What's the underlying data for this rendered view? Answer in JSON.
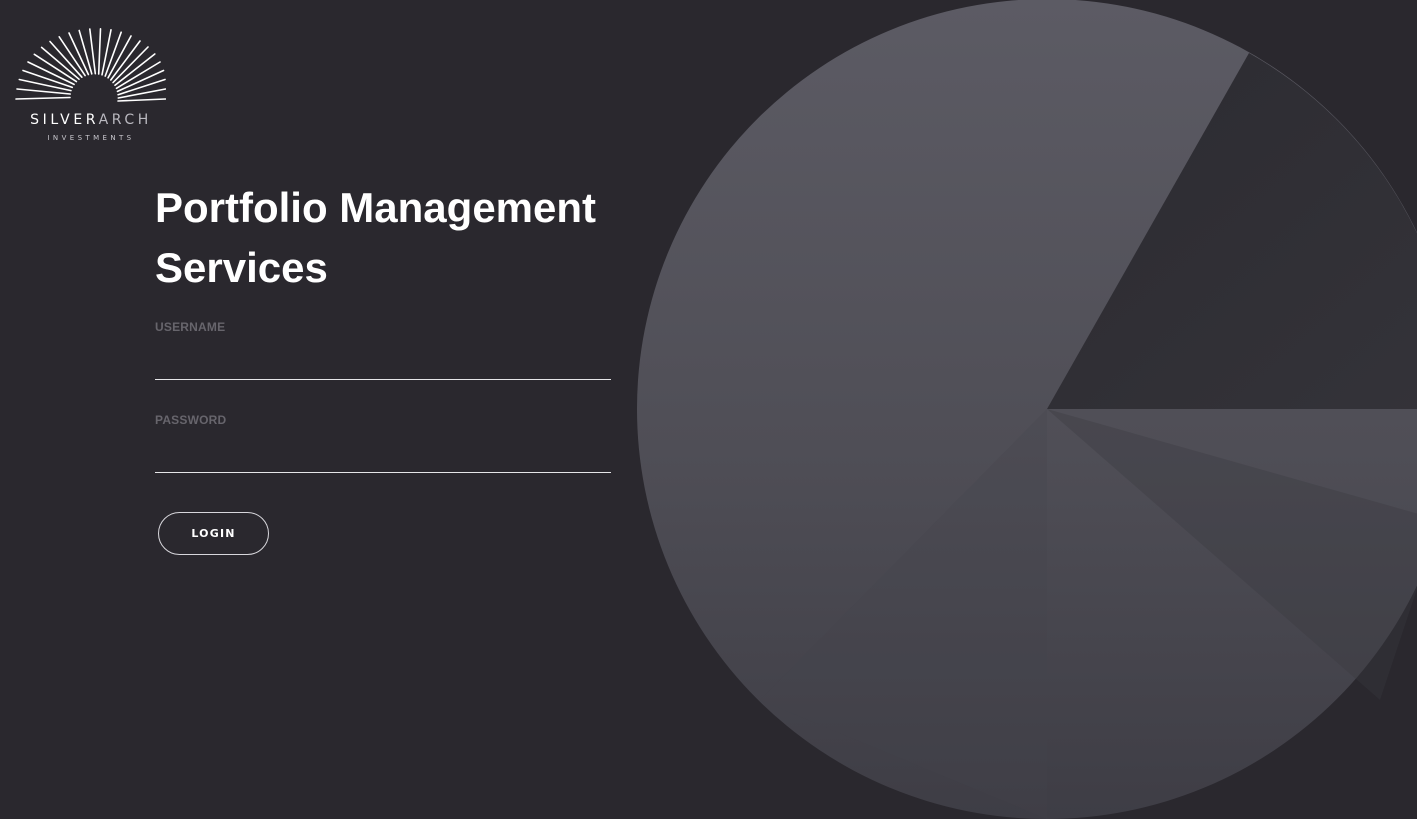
{
  "brand": {
    "name_part1": "SILVER",
    "name_part2": "ARCH",
    "tagline": "INVESTMENTS",
    "logo_icon": "sunburst-arch-icon"
  },
  "page": {
    "title": "Portfolio Management Services"
  },
  "form": {
    "username_label": "USERNAME",
    "username_value": "",
    "password_label": "PASSWORD",
    "password_value": "",
    "login_label": "LOGIN"
  },
  "colors": {
    "background": "#2a282e",
    "disc_light": "#5c5b64",
    "disc_dark": "#3d3c43",
    "label": "#67656c",
    "text": "#ffffff"
  }
}
